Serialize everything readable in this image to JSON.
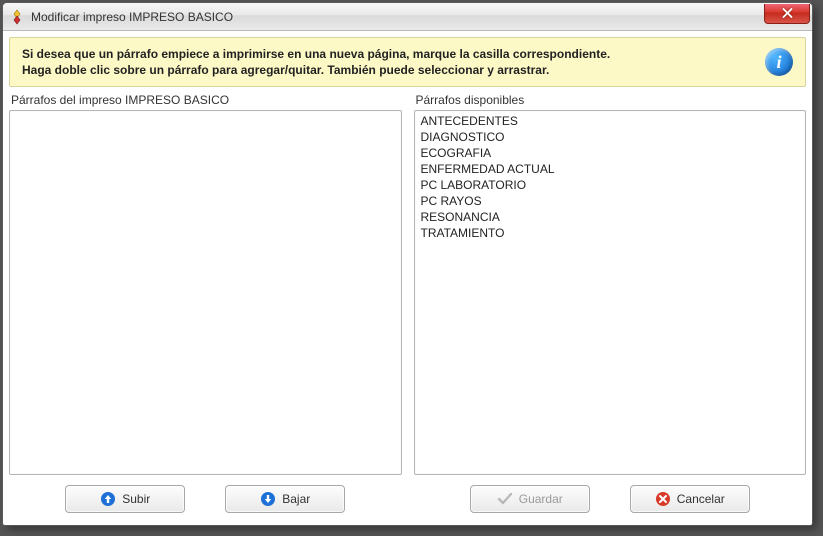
{
  "window": {
    "title": "Modificar impreso IMPRESO BASICO"
  },
  "banner": {
    "line1": "Si desea que un párrafo empiece a imprimirse en una nueva página, marque la casilla correspondiente.",
    "line2": "Haga doble clic sobre un párrafo para agregar/quitar. También puede seleccionar y arrastrar."
  },
  "left": {
    "label": "Párrafos del impreso IMPRESO BASICO",
    "items": []
  },
  "right": {
    "label": "Párrafos disponibles",
    "items": [
      "ANTECEDENTES",
      "DIAGNOSTICO",
      "ECOGRAFIA",
      "ENFERMEDAD ACTUAL",
      "PC LABORATORIO",
      "PC RAYOS",
      "RESONANCIA",
      "TRATAMIENTO"
    ]
  },
  "buttons": {
    "up": "Subir",
    "down": "Bajar",
    "save": "Guardar",
    "cancel": "Cancelar"
  }
}
